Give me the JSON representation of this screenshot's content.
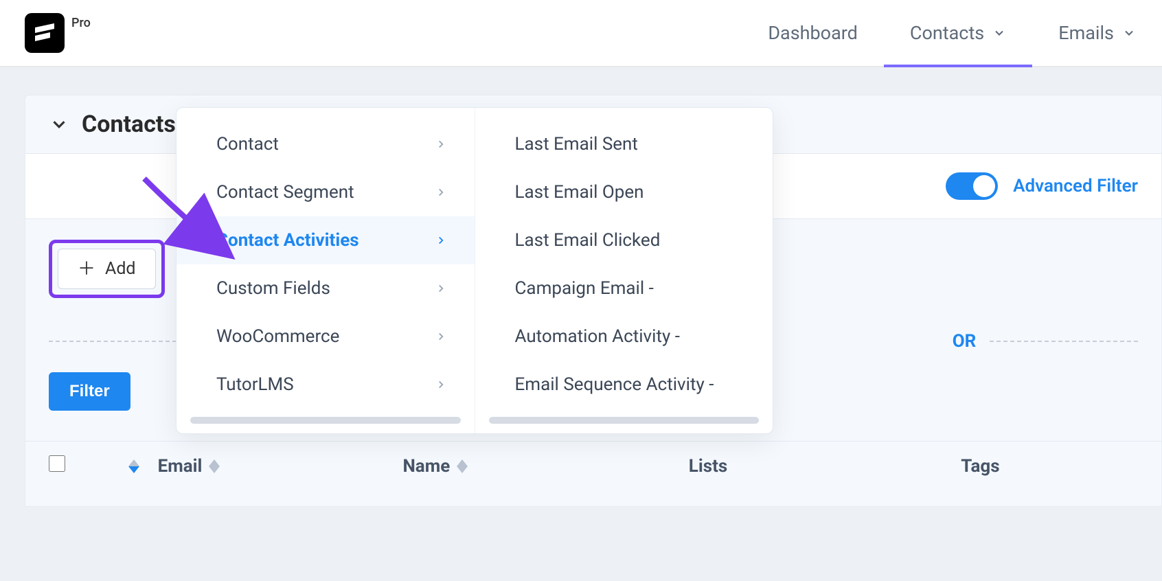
{
  "header": {
    "pro": "Pro",
    "nav": [
      "Dashboard",
      "Contacts",
      "Emails"
    ],
    "active_nav_index": 1
  },
  "page": {
    "title": "Contacts",
    "advanced_filter_label": "Advanced Filter",
    "add_label": "Add",
    "or_label": "OR",
    "filter_btn": "Filter"
  },
  "popover": {
    "left": [
      "Contact",
      "Contact Segment",
      "Contact Activities",
      "Custom Fields",
      "WooCommerce",
      "TutorLMS"
    ],
    "left_selected_index": 2,
    "right": [
      "Last Email Sent",
      "Last Email Open",
      "Last Email Clicked",
      "Campaign Email -",
      "Automation Activity -",
      "Email Sequence Activity -"
    ]
  },
  "table": {
    "columns": [
      "Email",
      "Name",
      "Lists",
      "Tags"
    ]
  }
}
